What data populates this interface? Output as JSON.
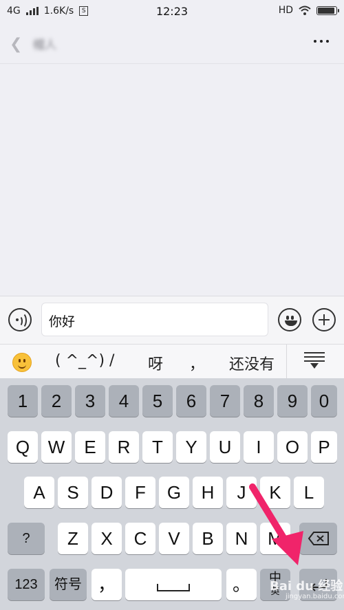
{
  "status_bar": {
    "network": "4G",
    "speed": "1.6K/s",
    "time": "12:23",
    "hd": "HD"
  },
  "header": {
    "contact_name": "帽人",
    "more_label": "···"
  },
  "input": {
    "text": "你好"
  },
  "candidates": [
    "( ^_^) /",
    "呀",
    "，",
    "还没有"
  ],
  "keyboard": {
    "row_numbers": [
      "1",
      "2",
      "3",
      "4",
      "5",
      "6",
      "7",
      "8",
      "9",
      "0"
    ],
    "row_q": [
      "Q",
      "W",
      "E",
      "R",
      "T",
      "Y",
      "U",
      "I",
      "O",
      "P"
    ],
    "row_a": [
      "A",
      "S",
      "D",
      "F",
      "G",
      "H",
      "J",
      "K",
      "L"
    ],
    "row_z": [
      "?",
      "Z",
      "X",
      "C",
      "V",
      "B",
      "N",
      "M"
    ],
    "key_123": "123",
    "key_symbols": "符号",
    "key_comma": "，",
    "key_period": "。",
    "key_lang": "中",
    "key_lang_sub": "英"
  },
  "watermark": {
    "text": "Bai du 经验",
    "url": "jingyan.baidu.com"
  },
  "accent_color": "#f0246a"
}
